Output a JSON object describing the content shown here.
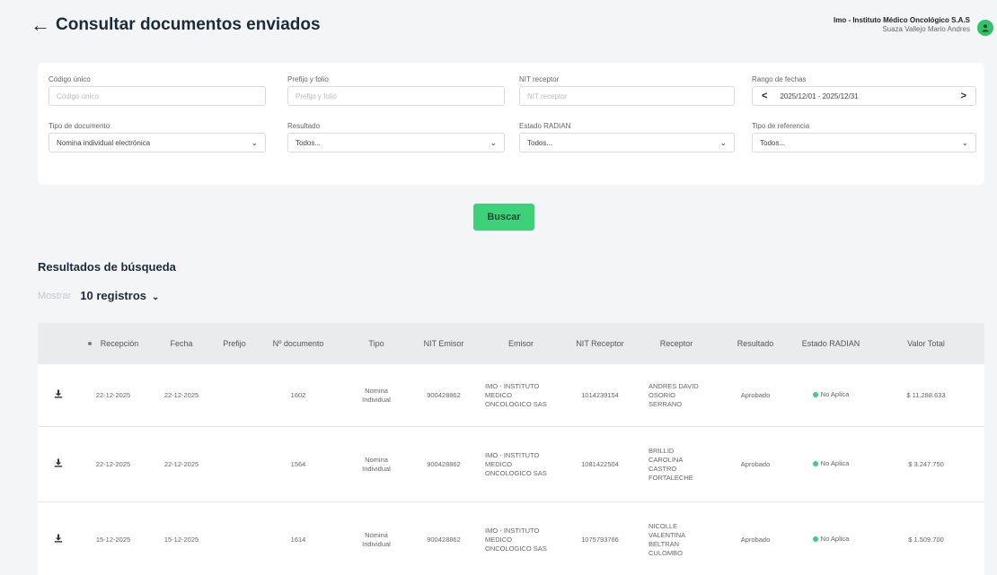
{
  "header": {
    "back_arrow": "←",
    "title": "Consultar documentos enviados",
    "org_name": "Imo - Instituto Médico Oncológico S.A.S",
    "user_name": "Suaza Vallejo Mario Andres"
  },
  "filters": {
    "codigo_unico": {
      "label": "Código único",
      "placeholder": "Código único"
    },
    "prefijo_folio": {
      "label": "Prefijo y folio",
      "placeholder": "Prefijo y folio"
    },
    "nit_receptor": {
      "label": "NIT receptor",
      "placeholder": "NIT receptor"
    },
    "rango_fechas": {
      "label": "Rango de fechas",
      "value": "2025/12/01 - 2025/12/31",
      "prev": "<",
      "next": ">"
    },
    "tipo_documento": {
      "label": "Tipo de documento",
      "value": "Nomina individual electrónica"
    },
    "resultado": {
      "label": "Resultado",
      "value": "Todos..."
    },
    "estado_radian": {
      "label": "Estado RADIAN",
      "value": "Todos..."
    },
    "tipo_referencia": {
      "label": "Tipo de referencia",
      "value": "Todos..."
    }
  },
  "search_button": "Buscar",
  "results": {
    "title": "Resultados de búsqueda",
    "show_label": "Mostrar",
    "show_value": "10 registros"
  },
  "table": {
    "headers": [
      "Recepción",
      "Fecha",
      "Prefijo",
      "Nº documento",
      "Tipo",
      "NIT Emisor",
      "Emisor",
      "NIT Receptor",
      "Receptor",
      "Resultado",
      "Estado RADIAN",
      "Valor Total"
    ],
    "rows": [
      {
        "recepcion": "22-12-2025",
        "fecha": "22-12-2025",
        "prefijo": "",
        "documento": "1602",
        "tipo": "Nomina Individual",
        "nit_emisor": "900428862",
        "emisor": "IMO - INSTITUTO MEDICO ONCOLOGICO SAS",
        "nit_receptor": "1014239154",
        "receptor": "ANDRES DAVID OSORIO SERRANO",
        "resultado": "Aprobado",
        "estado_radian": "No Aplica",
        "valor": "$ 11.288.633"
      },
      {
        "recepcion": "22-12-2025",
        "fecha": "22-12-2025",
        "prefijo": "",
        "documento": "1564",
        "tipo": "Nomina Individual",
        "nit_emisor": "900428862",
        "emisor": "IMO - INSTITUTO MEDICO ONCOLOGICO SAS",
        "nit_receptor": "1081422504",
        "receptor": "BRILLID CAROLINA CASTRO FORTALECHE",
        "resultado": "Aprobado",
        "estado_radian": "No Aplica",
        "valor": "$ 3.247.750"
      },
      {
        "recepcion": "15-12-2025",
        "fecha": "15-12-2025",
        "prefijo": "",
        "documento": "1614",
        "tipo": "Nomina Individual",
        "nit_emisor": "900428862",
        "emisor": "IMO - INSTITUTO MEDICO ONCOLOGICO SAS",
        "nit_receptor": "1075793766",
        "receptor": "NICOLLE VALENTINA BELTRAN CULOMBO",
        "resultado": "Aprobado",
        "estado_radian": "No Aplica",
        "valor": "$ 1.509.700"
      }
    ]
  },
  "icons": {
    "download": "download-icon",
    "avatar": "user-icon"
  },
  "colors": {
    "primary": "#3fd17a",
    "title": "#1e2a3a",
    "header_bg": "#eaebed"
  }
}
